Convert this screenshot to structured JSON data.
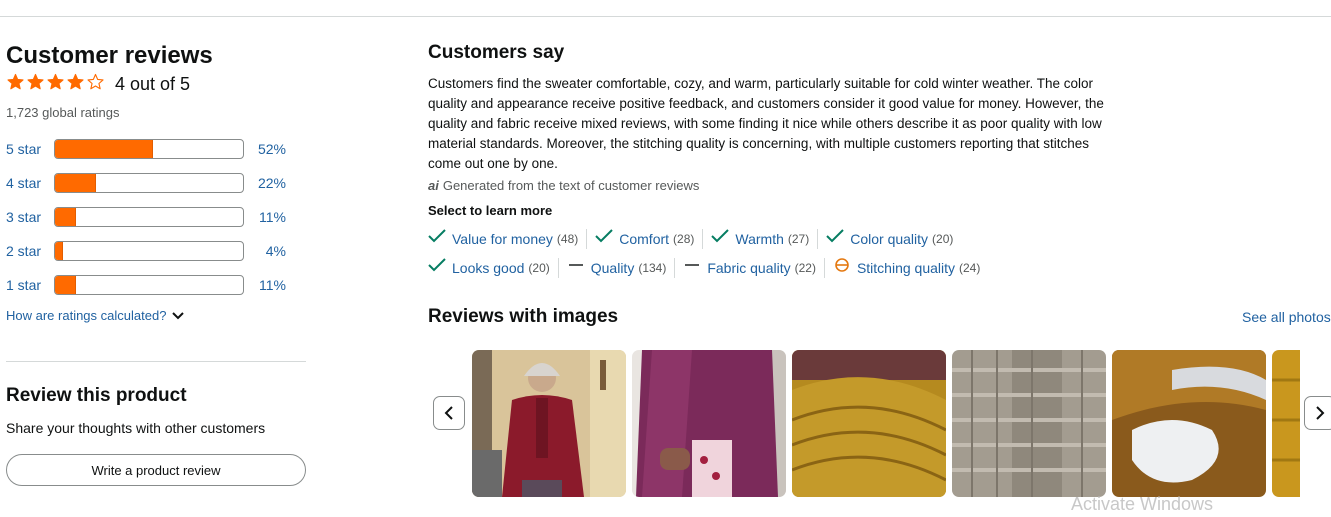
{
  "customer_reviews": {
    "title": "Customer reviews",
    "average_text": "4 out of 5",
    "average_rating": 4,
    "max_rating": 5,
    "global_ratings": "1,723 global ratings",
    "histogram": [
      {
        "label": "5 star",
        "pct_text": "52%",
        "pct": 52
      },
      {
        "label": "4 star",
        "pct_text": "22%",
        "pct": 22
      },
      {
        "label": "3 star",
        "pct_text": "11%",
        "pct": 11
      },
      {
        "label": "2 star",
        "pct_text": "4%",
        "pct": 4
      },
      {
        "label": "1 star",
        "pct_text": "11%",
        "pct": 11
      }
    ],
    "how_calculated": "How are ratings calculated?"
  },
  "review_product": {
    "title": "Review this product",
    "subtitle": "Share your thoughts with other customers",
    "button_label": "Write a product review"
  },
  "customers_say": {
    "title": "Customers say",
    "summary": "Customers find the sweater comfortable, cozy, and warm, particularly suitable for cold winter weather. The color quality and appearance receive positive feedback, and customers consider it good value for money. However, the quality and fabric receive mixed reviews, with some finding it nice while others describe it as poor quality with low material standards. Moreover, the stitching quality is concerning, with multiple customers reporting that stitches come out one by one.",
    "ai_note": "Generated from the text of customer reviews",
    "select_title": "Select to learn more",
    "aspects_row1": [
      {
        "name": "Value for money",
        "count": "(48)",
        "sentiment": "positive"
      },
      {
        "name": "Comfort",
        "count": "(28)",
        "sentiment": "positive"
      },
      {
        "name": "Warmth",
        "count": "(27)",
        "sentiment": "positive"
      },
      {
        "name": "Color quality",
        "count": "(20)",
        "sentiment": "positive"
      }
    ],
    "aspects_row2": [
      {
        "name": "Looks good",
        "count": "(20)",
        "sentiment": "positive"
      },
      {
        "name": "Quality",
        "count": "(134)",
        "sentiment": "mixed"
      },
      {
        "name": "Fabric quality",
        "count": "(22)",
        "sentiment": "mixed"
      },
      {
        "name": "Stitching quality",
        "count": "(24)",
        "sentiment": "negative"
      }
    ]
  },
  "reviews_with_images": {
    "title": "Reviews with images",
    "see_all": "See all photos"
  },
  "watermark": "Activate Windows",
  "colors": {
    "accent_orange": "#ff6a00",
    "link_blue": "#2162a1",
    "positive_green": "#067d62",
    "negative_orange": "#e47911"
  }
}
